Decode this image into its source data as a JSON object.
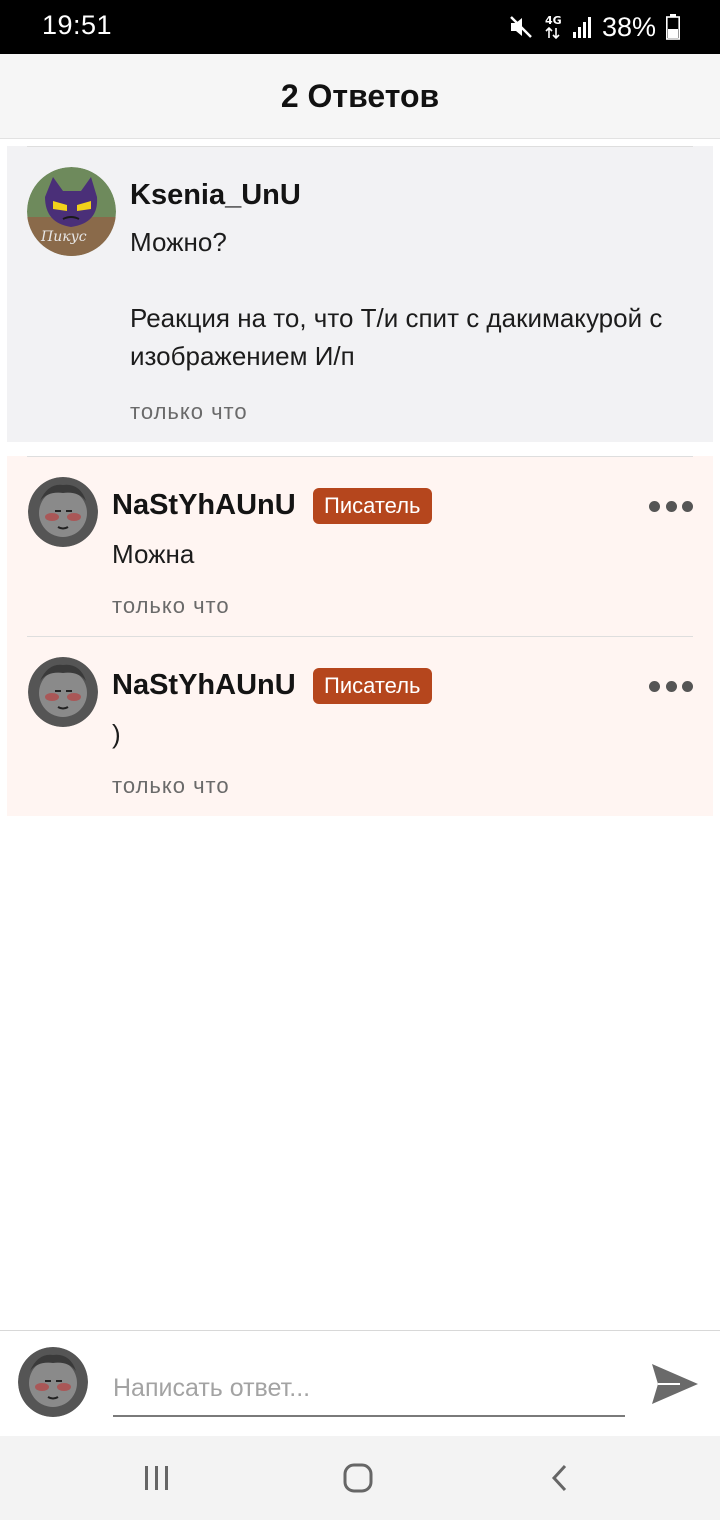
{
  "status_bar": {
    "time": "19:51",
    "network": "4G",
    "battery": "38%",
    "icons": [
      "mute-icon",
      "network-4g-icon",
      "signal-icon",
      "battery-icon"
    ]
  },
  "header": {
    "title": "2 Ответов"
  },
  "parent_comment": {
    "username": "Ksenia_UnU",
    "text": "Можно?\n\nРеакция на то, что Т/и спит с дакимакурой с изображением И/п",
    "timestamp": "только что",
    "avatar": "avatar-image"
  },
  "replies": [
    {
      "username": "NaStYhAUnU",
      "badge": "Писатель",
      "text": "Можна",
      "timestamp": "только что",
      "avatar": "avatar-image"
    },
    {
      "username": "NaStYhAUnU",
      "badge": "Писатель",
      "text": ")",
      "timestamp": "только что",
      "avatar": "avatar-image"
    }
  ],
  "composer": {
    "placeholder": "Написать ответ...",
    "value": ""
  },
  "colors": {
    "badge": "#b5461d",
    "reply_background": "#fff5f2",
    "parent_background": "#f2f2f4"
  }
}
